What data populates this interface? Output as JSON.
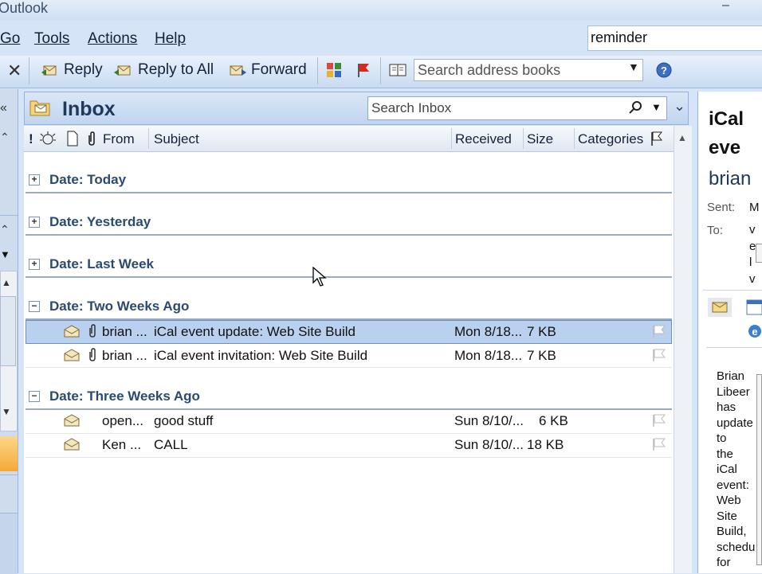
{
  "window": {
    "title": "Outlook",
    "minimize": "–"
  },
  "menu": [
    "Go",
    "Tools",
    "Actions",
    "Help"
  ],
  "help_search": "reminder",
  "toolbar": {
    "reply": "Reply",
    "reply_all": "Reply to All",
    "forward": "Forward",
    "address_placeholder": "Search address books"
  },
  "inbox": {
    "title": "Inbox",
    "search_placeholder": "Search Inbox",
    "columns": {
      "from": "From",
      "subject": "Subject",
      "received": "Received",
      "size": "Size",
      "categories": "Categories"
    }
  },
  "groups": [
    {
      "label": "Date: Today",
      "expanded": false
    },
    {
      "label": "Date: Yesterday",
      "expanded": false
    },
    {
      "label": "Date: Last Week",
      "expanded": false
    },
    {
      "label": "Date: Two Weeks Ago",
      "expanded": true
    },
    {
      "label": "Date: Three Weeks Ago",
      "expanded": true
    }
  ],
  "messages": [
    {
      "from": "brian ...",
      "subject": "iCal event update: Web Site Build",
      "received": "Mon 8/18...",
      "size": "7 KB",
      "attachment": true,
      "selected": true
    },
    {
      "from": "brian ...",
      "subject": "iCal event invitation: Web Site Build",
      "received": "Mon 8/18...",
      "size": "7 KB",
      "attachment": true,
      "selected": false
    },
    {
      "from": "open...",
      "subject": "good stuff",
      "received": "Sun 8/10/...",
      "size": "6 KB",
      "attachment": false,
      "selected": false
    },
    {
      "from": "Ken ...",
      "subject": "CALL",
      "received": "Sun 8/10/...",
      "size": "18 KB",
      "attachment": false,
      "selected": false
    }
  ],
  "reading": {
    "title_lines": [
      "iCal",
      "eve"
    ],
    "sender": "brian",
    "sent_label": "Sent:",
    "sent_value": "M",
    "to_label": "To:",
    "to_lines": [
      "v",
      "e",
      "l",
      "v"
    ],
    "body_lines": [
      "Brian",
      "Libeer",
      "has",
      "update",
      "to",
      "the",
      "iCal",
      "event:",
      "Web",
      "Site",
      "Build,",
      "schedu",
      "for"
    ]
  },
  "colors": {
    "accent": "#1e395b",
    "selected_row": "#b9d0ee",
    "chrome": "#d6e4f7"
  }
}
